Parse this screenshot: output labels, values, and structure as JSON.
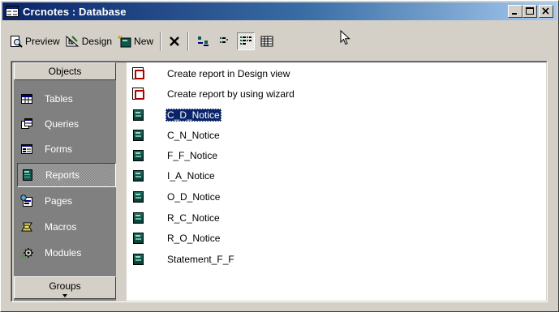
{
  "window": {
    "title": "Crcnotes : Database"
  },
  "toolbar": {
    "preview_label": "Preview",
    "design_label": "Design",
    "new_label": "New"
  },
  "objects_bar": {
    "header": "Objects",
    "items": [
      {
        "label": "Tables",
        "icon": "table-icon"
      },
      {
        "label": "Queries",
        "icon": "query-icon"
      },
      {
        "label": "Forms",
        "icon": "form-icon"
      },
      {
        "label": "Reports",
        "icon": "report-icon",
        "selected": true
      },
      {
        "label": "Pages",
        "icon": "page-icon"
      },
      {
        "label": "Macros",
        "icon": "macro-icon"
      },
      {
        "label": "Modules",
        "icon": "module-icon"
      }
    ],
    "groups_label": "Groups"
  },
  "list": {
    "items": [
      {
        "label": "Create report in Design view",
        "icon": "wizard-icon"
      },
      {
        "label": "Create report by using wizard",
        "icon": "wizard-icon"
      },
      {
        "label": "C_D_Notice",
        "icon": "report-icon",
        "selected": true
      },
      {
        "label": "C_N_Notice",
        "icon": "report-icon"
      },
      {
        "label": "F_F_Notice",
        "icon": "report-icon"
      },
      {
        "label": "I_A_Notice",
        "icon": "report-icon"
      },
      {
        "label": "O_D_Notice",
        "icon": "report-icon"
      },
      {
        "label": "R_C_Notice",
        "icon": "report-icon"
      },
      {
        "label": "R_O_Notice",
        "icon": "report-icon"
      },
      {
        "label": "Statement_F_F",
        "icon": "report-icon"
      }
    ]
  },
  "colors": {
    "titlebar_start": "#0a246a",
    "titlebar_end": "#a6caf0",
    "selection": "#0a246a",
    "face": "#d4d0c8",
    "bar_bg": "#808080"
  }
}
